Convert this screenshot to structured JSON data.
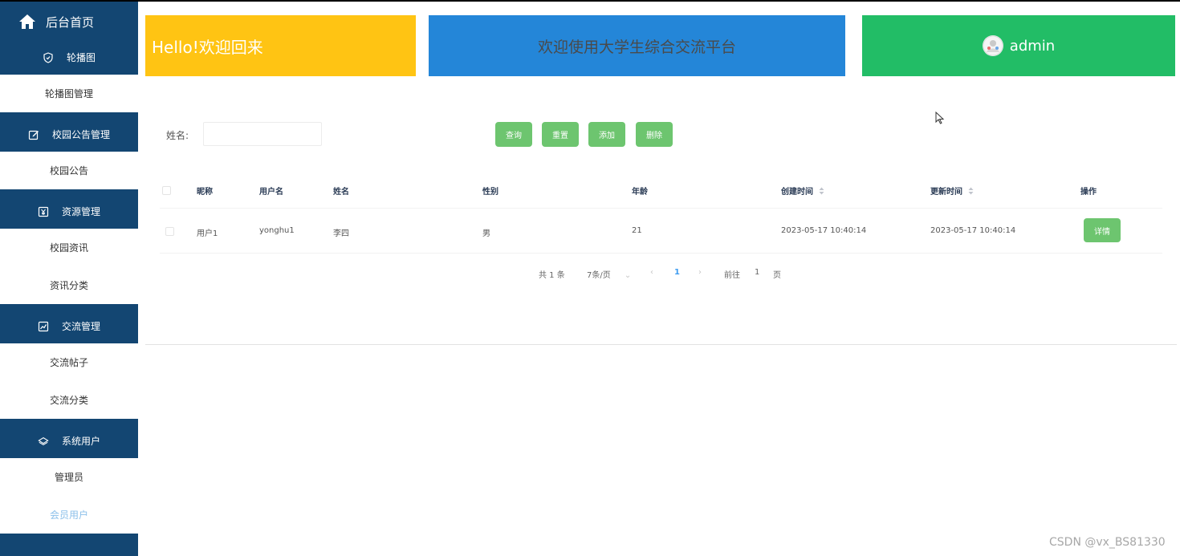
{
  "sidebar": {
    "home_label": "后台首页",
    "groups": [
      {
        "label": "轮播图",
        "icon": "shield-icon",
        "items": [
          "轮播图管理"
        ]
      },
      {
        "label": "校园公告管理",
        "icon": "edit-icon",
        "items": [
          "校园公告"
        ]
      },
      {
        "label": "资源管理",
        "icon": "yen-icon",
        "items": [
          "校园资讯",
          "资讯分类"
        ]
      },
      {
        "label": "交流管理",
        "icon": "chart-icon",
        "items": [
          "交流帖子",
          "交流分类"
        ]
      },
      {
        "label": "系统用户",
        "icon": "layers-icon",
        "items": [
          "管理员",
          "会员用户"
        ]
      }
    ],
    "active_item": "会员用户"
  },
  "cards": {
    "welcome": "Hello!欢迎回来",
    "platform": "欢迎使用大学生综合交流平台",
    "user": "admin"
  },
  "search": {
    "name_label": "姓名:",
    "name_value": "",
    "buttons": {
      "query": "查询",
      "reset": "重置",
      "add": "添加",
      "delete": "删除"
    }
  },
  "table": {
    "headers": [
      "昵称",
      "用户名",
      "姓名",
      "性别",
      "年龄",
      "创建时间",
      "更新时间",
      "操作"
    ],
    "rows": [
      {
        "nickname": "用户1",
        "username": "yonghu1",
        "name": "李四",
        "gender": "男",
        "age": "21",
        "created": "2023-05-17 10:40:14",
        "updated": "2023-05-17 10:40:14",
        "action": "详情"
      }
    ]
  },
  "pagination": {
    "total": "共 1 条",
    "page_size": "7条/页",
    "current_page": "1",
    "goto_prefix": "前往",
    "goto_value": "1",
    "goto_suffix": "页"
  },
  "watermark": "CSDN @vx_BS81330",
  "colors": {
    "sidebar": "#134672",
    "card_yellow": "#ffc413",
    "card_blue": "#2486d8",
    "card_green": "#22bd66",
    "button_green": "#6dc56f",
    "page_active": "#3c9bf0"
  }
}
